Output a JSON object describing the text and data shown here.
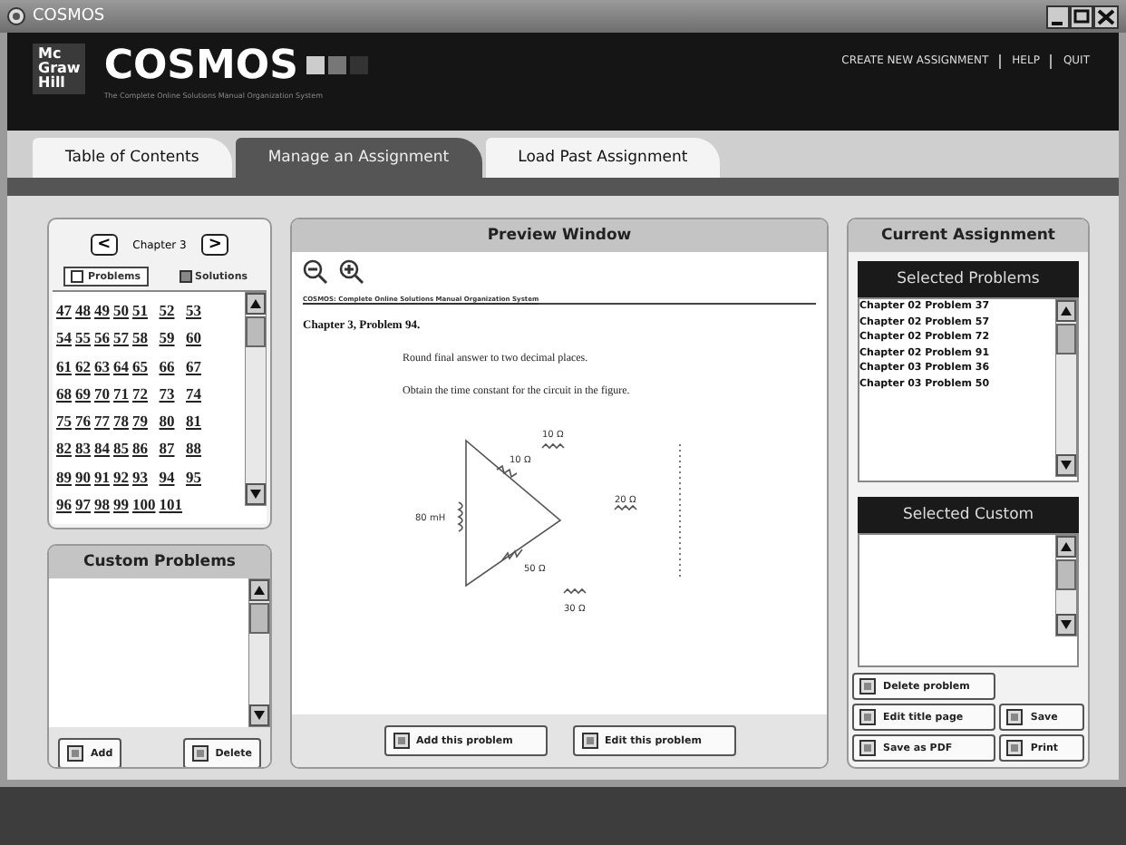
{
  "window": {
    "title": "COSMOS"
  },
  "header": {
    "publisher_logo": [
      "Mc",
      "Graw",
      "Hill"
    ],
    "logo": "COSMOS",
    "tagline": "The Complete Online Solutions Manual Organization System",
    "links": [
      "CREATE NEW ASSIGNMENT",
      "HELP",
      "QUIT"
    ]
  },
  "tabs": [
    {
      "label": "Table of Contents",
      "selected": false
    },
    {
      "label": "Manage an Assignment",
      "selected": true
    },
    {
      "label": "Load Past Assignment",
      "selected": false
    }
  ],
  "chapter_nav": {
    "prev": "<",
    "label": "Chapter 3",
    "next": ">"
  },
  "view_options": [
    {
      "label": "Problems",
      "selected": true
    },
    {
      "label": "Solutions",
      "selected": false
    }
  ],
  "problem_numbers": [
    "47",
    "48",
    "49",
    "50",
    "51",
    "52",
    "53",
    "54",
    "55",
    "56",
    "57",
    "58",
    "59",
    "60",
    "61",
    "62",
    "63",
    "64",
    "65",
    "66",
    "67",
    "68",
    "69",
    "70",
    "71",
    "72",
    "73",
    "74",
    "75",
    "76",
    "77",
    "78",
    "79",
    "80",
    "81",
    "82",
    "83",
    "84",
    "85",
    "86",
    "87",
    "88",
    "89",
    "90",
    "91",
    "92",
    "93",
    "94",
    "95",
    "96",
    "97",
    "98",
    "99",
    "100",
    "101"
  ],
  "custom_problems": {
    "title": "Custom Problems",
    "buttons": [
      "Add",
      "Delete"
    ]
  },
  "preview": {
    "title": "Preview Window",
    "source_line": "COSMOS: Complete Online Solutions Manual Organization System",
    "heading": "Chapter 3, Problem 94.",
    "lines": [
      "Round final answer to two decimal places.",
      "Obtain the time constant for the circuit in the figure."
    ],
    "figure_labels": [
      "10 Ω",
      "10 Ω",
      "80 mH",
      "20 Ω",
      "50 Ω",
      "30 Ω"
    ],
    "buttons": [
      "Add this problem",
      "Edit this problem"
    ]
  },
  "current_assignment": {
    "title": "Current Assignment",
    "selected_problems": {
      "title": "Selected Problems",
      "items": [
        "Chapter 02 Problem 37",
        "Chapter 02 Problem 57",
        "Chapter 02 Problem 72",
        "Chapter 02 Problem 91",
        "Chapter 03 Problem 36",
        "Chapter 03 Problem 50"
      ]
    },
    "selected_custom": {
      "title": "Selected Custom"
    },
    "buttons": [
      "Delete problem",
      "Edit title page",
      "Save",
      "Save as PDF",
      "Print"
    ]
  }
}
